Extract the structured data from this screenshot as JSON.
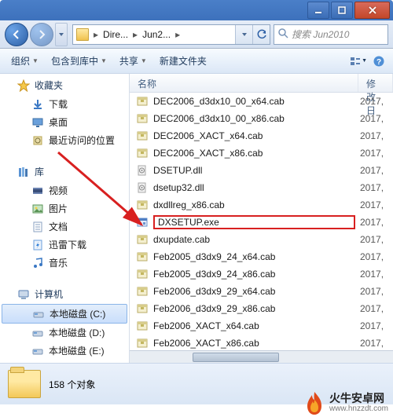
{
  "titlebar": {},
  "nav": {
    "crumb1": "Dire...",
    "crumb2": "Jun2...",
    "search_placeholder": "搜索 Jun2010"
  },
  "toolbar": {
    "organize": "组织",
    "include": "包含到库中",
    "share": "共享",
    "newfolder": "新建文件夹"
  },
  "sidebar": {
    "favorites": {
      "label": "收藏夹",
      "items": [
        "下载",
        "桌面",
        "最近访问的位置"
      ]
    },
    "libraries": {
      "label": "库",
      "items": [
        "视频",
        "图片",
        "文档",
        "迅雷下载",
        "音乐"
      ]
    },
    "computer": {
      "label": "计算机",
      "items": [
        "本地磁盘 (C:)",
        "本地磁盘 (D:)",
        "本地磁盘 (E:)"
      ]
    },
    "selected_index": 0
  },
  "columns": {
    "name": "名称",
    "date": "修改日"
  },
  "files": [
    {
      "n": "DEC2006_d3dx10_00_x64.cab",
      "t": "cab",
      "d": "2017,"
    },
    {
      "n": "DEC2006_d3dx10_00_x86.cab",
      "t": "cab",
      "d": "2017,"
    },
    {
      "n": "DEC2006_XACT_x64.cab",
      "t": "cab",
      "d": "2017,"
    },
    {
      "n": "DEC2006_XACT_x86.cab",
      "t": "cab",
      "d": "2017,"
    },
    {
      "n": "DSETUP.dll",
      "t": "dll",
      "d": "2017,"
    },
    {
      "n": "dsetup32.dll",
      "t": "dll",
      "d": "2017,"
    },
    {
      "n": "dxdllreg_x86.cab",
      "t": "cab",
      "d": "2017,"
    },
    {
      "n": "DXSETUP.exe",
      "t": "exe",
      "d": "2017,",
      "hl": true
    },
    {
      "n": "dxupdate.cab",
      "t": "cab",
      "d": "2017,"
    },
    {
      "n": "Feb2005_d3dx9_24_x64.cab",
      "t": "cab",
      "d": "2017,"
    },
    {
      "n": "Feb2005_d3dx9_24_x86.cab",
      "t": "cab",
      "d": "2017,"
    },
    {
      "n": "Feb2006_d3dx9_29_x64.cab",
      "t": "cab",
      "d": "2017,"
    },
    {
      "n": "Feb2006_d3dx9_29_x86.cab",
      "t": "cab",
      "d": "2017,"
    },
    {
      "n": "Feb2006_XACT_x64.cab",
      "t": "cab",
      "d": "2017,"
    },
    {
      "n": "Feb2006_XACT_x86.cab",
      "t": "cab",
      "d": "2017,"
    }
  ],
  "details": {
    "count": "158 个对象"
  },
  "watermark": {
    "name": "火牛安卓网",
    "url": "www.hnzzdt.com"
  }
}
